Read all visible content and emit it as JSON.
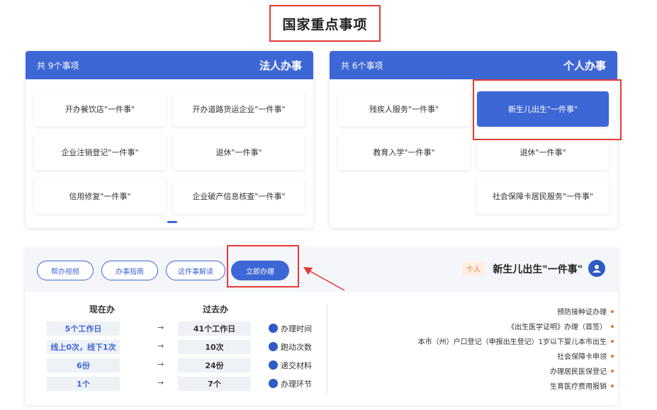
{
  "page_title": "国家重点事项",
  "panels": {
    "legal": {
      "title": "法人办事",
      "count": "共 9个事项",
      "items": [
        "开办道路货运企业\"一件事\"",
        "开办餐饮店\"一件事\"",
        "退休\"一件事\"",
        "企业注销登记\"一件事\"",
        "企业破产信息核查\"一件事\"",
        "信用修复\"一件事\""
      ]
    },
    "personal": {
      "title": "个人办事",
      "count": "共 6个事项",
      "items": [
        "新生儿出生\"一件事\"",
        "残疾人服务\"一件事\"",
        "退休\"一件事\"",
        "教育入学\"一件事\"",
        "社会保障卡居民服务\"一件事\""
      ]
    }
  },
  "detail": {
    "title": "新生儿出生\"一件事\"",
    "badge": "个人",
    "buttons": {
      "apply": "立即办理",
      "policy": "这件事解读",
      "guide": "办事指南",
      "help": "帮办视频"
    },
    "compare": {
      "head_before": "过去办",
      "head_now": "现在办",
      "rows": [
        {
          "label": "办理时间",
          "icon": "clock-icon",
          "before": "41个工作日",
          "now": "5个工作日"
        },
        {
          "label": "跑动次数",
          "icon": "run-icon",
          "before": "10次",
          "now": "线上0次，线下1次"
        },
        {
          "label": "递交材料",
          "icon": "folder-icon",
          "before": "24份",
          "now": "6份"
        },
        {
          "label": "办理环节",
          "icon": "steps-icon",
          "before": "7个",
          "now": "1个"
        }
      ],
      "arrow": "→"
    },
    "steps": [
      "预防接种证办理",
      "《出生医学证明》办理（首签）",
      "本市（州）户口登记（申报出生登记）1岁以下婴儿本市出生",
      "社会保障卡申领",
      "办理居民医保登记",
      "生育医疗费用报销"
    ]
  },
  "colors": {
    "primary": "#3e67d6",
    "highlight": "#e53935",
    "badge": "#e8742a"
  }
}
